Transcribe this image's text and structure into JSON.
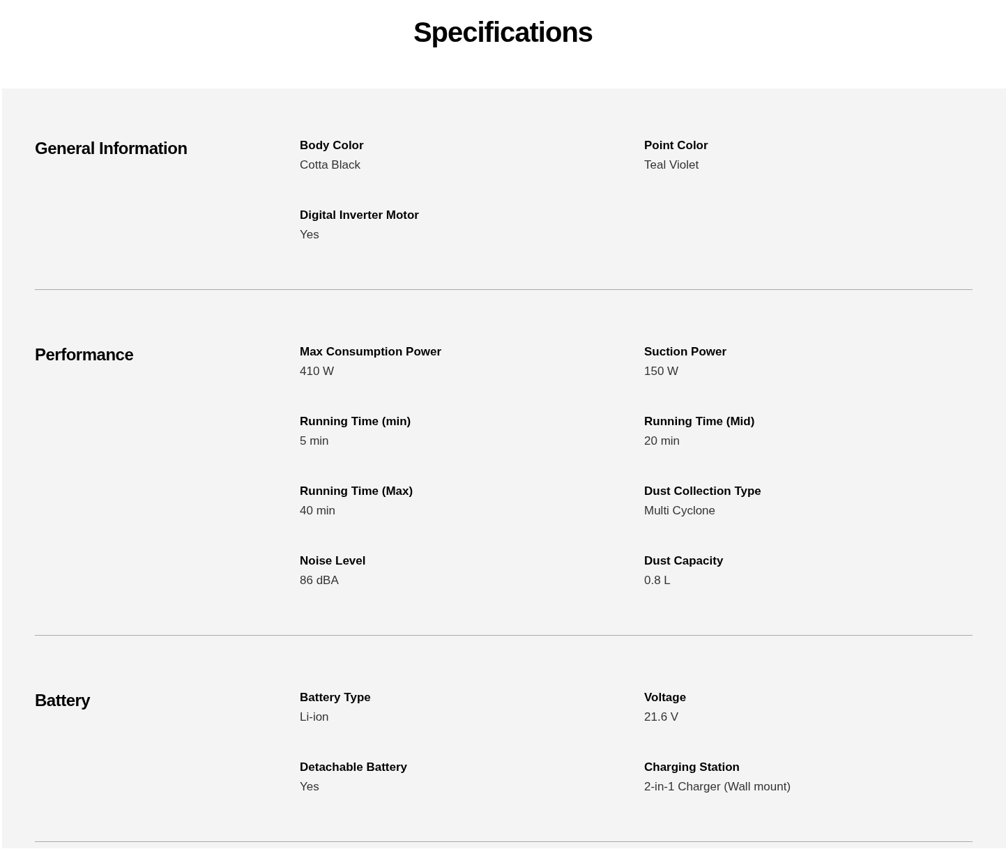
{
  "title": "Specifications",
  "sections": [
    {
      "heading": "General Information",
      "specs": [
        {
          "label": "Body Color",
          "value": "Cotta Black"
        },
        {
          "label": "Point Color",
          "value": "Teal Violet"
        },
        {
          "label": "Digital Inverter Motor",
          "value": "Yes"
        }
      ]
    },
    {
      "heading": "Performance",
      "specs": [
        {
          "label": "Max Consumption Power",
          "value": "410 W"
        },
        {
          "label": "Suction Power",
          "value": "150 W"
        },
        {
          "label": "Running Time (min)",
          "value": "5 min"
        },
        {
          "label": "Running Time (Mid)",
          "value": "20 min"
        },
        {
          "label": "Running Time (Max)",
          "value": "40 min"
        },
        {
          "label": "Dust Collection Type",
          "value": "Multi Cyclone"
        },
        {
          "label": "Noise Level",
          "value": "86 dBA"
        },
        {
          "label": "Dust Capacity",
          "value": "0.8 L"
        }
      ]
    },
    {
      "heading": "Battery",
      "specs": [
        {
          "label": "Battery Type",
          "value": "Li-ion"
        },
        {
          "label": "Voltage",
          "value": "21.6 V"
        },
        {
          "label": "Detachable Battery",
          "value": "Yes"
        },
        {
          "label": "Charging Station",
          "value": "2-in-1 Charger (Wall mount)"
        }
      ]
    }
  ]
}
